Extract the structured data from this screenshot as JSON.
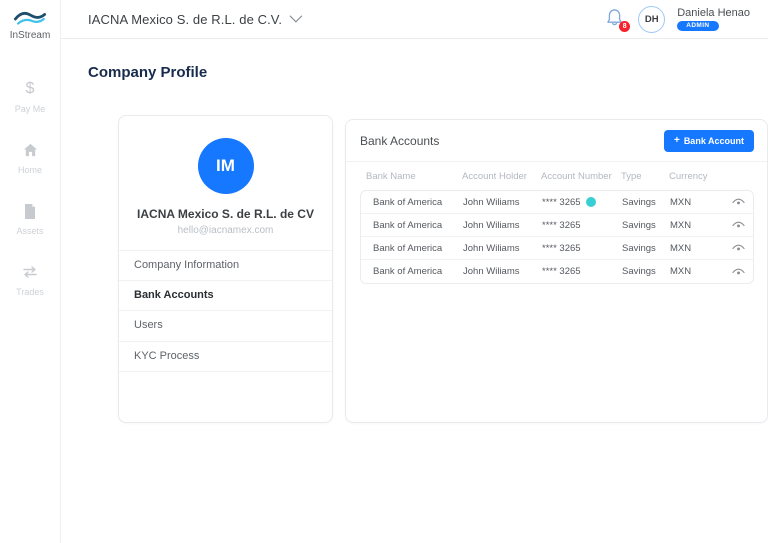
{
  "brand": {
    "name": "InStream"
  },
  "header": {
    "company_selector": "IACNA Mexico S. de R.L. de C.V.",
    "notification_count": "8",
    "user": {
      "initials": "DH",
      "name": "Daniela Henao",
      "role": "ADMIN"
    }
  },
  "sidebar": {
    "items": [
      {
        "icon": "dollar-icon",
        "label": "Pay Me"
      },
      {
        "icon": "home-icon",
        "label": "Home"
      },
      {
        "icon": "document-icon",
        "label": "Assets"
      },
      {
        "icon": "transfer-icon",
        "label": "Trades"
      }
    ]
  },
  "page": {
    "title": "Company Profile"
  },
  "profile_card": {
    "initials": "IM",
    "company_name": "IACNA Mexico S. de R.L. de CV",
    "email": "hello@iacnamex.com",
    "menu": [
      {
        "label": "Company Information",
        "active": false
      },
      {
        "label": "Bank Accounts",
        "active": true
      },
      {
        "label": "Users",
        "active": false
      },
      {
        "label": "KYC Process",
        "active": false
      }
    ]
  },
  "bank_panel": {
    "title": "Bank Accounts",
    "add_button": {
      "plus": "+",
      "label": "Bank Account"
    },
    "table": {
      "columns": [
        "Bank Name",
        "Account Holder",
        "Account Number",
        "Type",
        "Currency"
      ],
      "rows": [
        {
          "bank": "Bank of America",
          "holder": "John Wiliams",
          "number": "**** 3265",
          "badge": true,
          "type": "Savings",
          "currency": "MXN"
        },
        {
          "bank": "Bank of America",
          "holder": "John Wiliams",
          "number": "**** 3265",
          "badge": false,
          "type": "Savings",
          "currency": "MXN"
        },
        {
          "bank": "Bank of America",
          "holder": "John Wiliams",
          "number": "**** 3265",
          "badge": false,
          "type": "Savings",
          "currency": "MXN"
        },
        {
          "bank": "Bank of America",
          "holder": "John Wiliams",
          "number": "**** 3265",
          "badge": false,
          "type": "Savings",
          "currency": "MXN"
        }
      ]
    }
  },
  "colors": {
    "primary_blue": "#1677ff",
    "navy_heading": "#172b4d",
    "badge_red": "#f5222d",
    "teal_badge": "#38cfd4",
    "logo_dark_wave": "#1d4e6e",
    "logo_light_wave": "#3ec1ea"
  }
}
